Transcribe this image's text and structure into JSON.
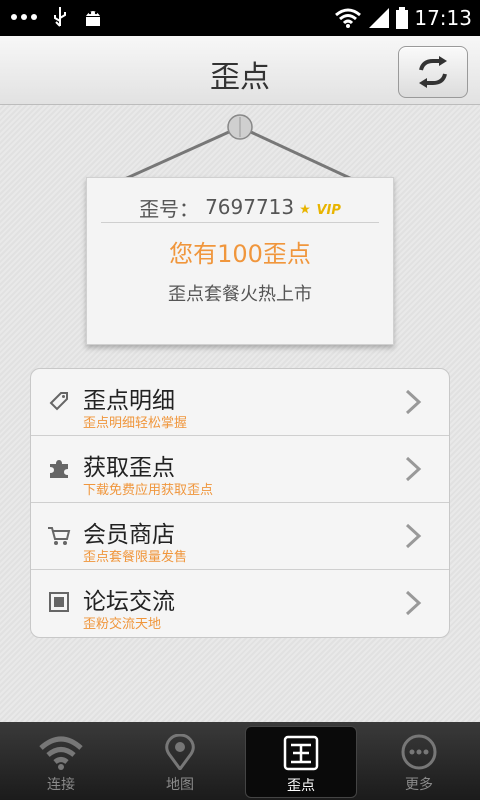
{
  "status_bar": {
    "time": "17:13"
  },
  "header": {
    "title": "歪点"
  },
  "card": {
    "id_label": "歪号：",
    "id_value": "7697713",
    "vip_badge": "VIP",
    "points_text": "您有100歪点",
    "promo_text": "歪点套餐火热上市"
  },
  "menu": [
    {
      "title": "歪点明细",
      "subtitle": "歪点明细轻松掌握",
      "icon": "tag-icon"
    },
    {
      "title": "获取歪点",
      "subtitle": "下载免费应用获取歪点",
      "icon": "puzzle-icon"
    },
    {
      "title": "会员商店",
      "subtitle": "歪点套餐限量发售",
      "icon": "cart-icon"
    },
    {
      "title": "论坛交流",
      "subtitle": "歪粉交流天地",
      "icon": "forum-icon"
    }
  ],
  "tabs": [
    {
      "label": "连接",
      "icon": "wifi-icon"
    },
    {
      "label": "地图",
      "icon": "map-pin-icon"
    },
    {
      "label": "歪点",
      "icon": "waidian-icon"
    },
    {
      "label": "更多",
      "icon": "more-icon"
    }
  ],
  "colors": {
    "accent": "#f0963c",
    "vip": "#e8b400",
    "tabbar": "#222222"
  }
}
